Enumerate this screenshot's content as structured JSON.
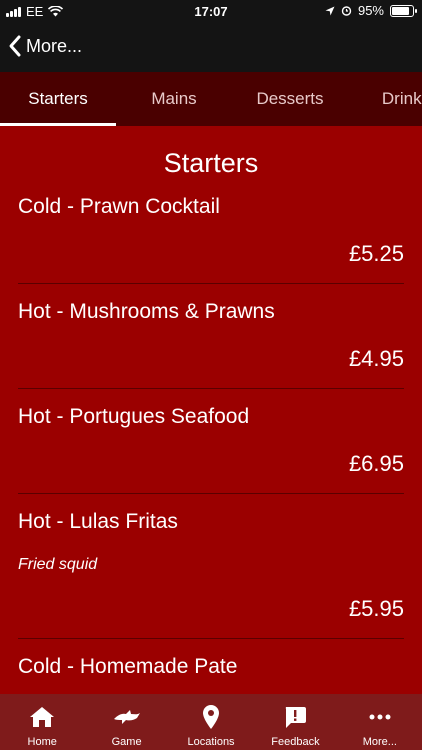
{
  "status_bar": {
    "carrier": "EE",
    "time": "17:07",
    "battery": "95%",
    "battery_level": 0.95
  },
  "nav": {
    "back_label": "More..."
  },
  "tabs": [
    {
      "label": "Starters",
      "active": true
    },
    {
      "label": "Mains",
      "active": false
    },
    {
      "label": "Desserts",
      "active": false
    },
    {
      "label": "Drinks",
      "active": false
    }
  ],
  "section_title": "Starters",
  "items": [
    {
      "name": "Cold - Prawn Cocktail",
      "description": "",
      "price": "£5.25"
    },
    {
      "name": "Hot - Mushrooms & Prawns",
      "description": "",
      "price": "£4.95"
    },
    {
      "name": "Hot - Portugues Seafood",
      "description": "",
      "price": "£6.95"
    },
    {
      "name": "Hot - Lulas Fritas",
      "description": "Fried squid",
      "price": "£5.95"
    },
    {
      "name": "Cold - Homemade Pate",
      "description": "",
      "price": ""
    }
  ],
  "tab_bar": [
    {
      "label": "Home",
      "icon": "home-icon"
    },
    {
      "label": "Game",
      "icon": "game-icon"
    },
    {
      "label": "Locations",
      "icon": "location-pin-icon"
    },
    {
      "label": "Feedback",
      "icon": "feedback-icon"
    },
    {
      "label": "More...",
      "icon": "more-icon"
    }
  ],
  "colors": {
    "background": "#9b0000",
    "tabs_bg": "#4a0000",
    "tab_bar_bg": "#7f1b1b",
    "nav_bg": "#141414"
  }
}
